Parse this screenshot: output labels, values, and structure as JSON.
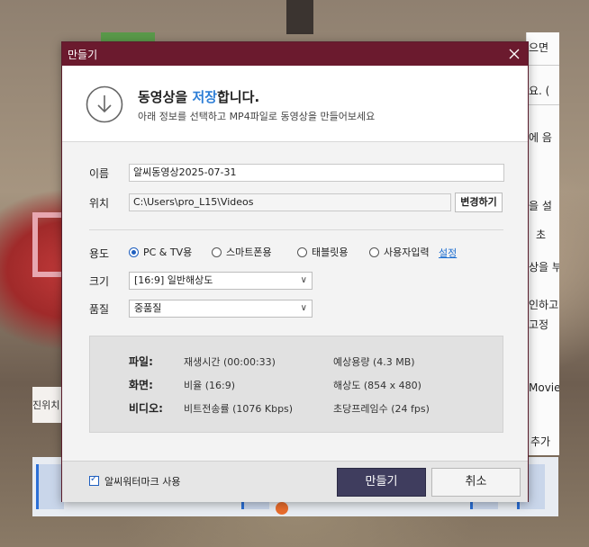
{
  "background": {
    "left_panel_text": "진위치",
    "right_panel_rows": [
      "으면",
      "요. (",
      "에 음",
      "을 설",
      "초",
      "상을 부",
      "인하고",
      "고정",
      "Movie",
      "추가"
    ]
  },
  "dialog": {
    "title": "만들기",
    "heading_prefix": "동영상을 ",
    "heading_accent": "저장",
    "heading_suffix": "합니다.",
    "subheading": "아래 정보를 선택하고 MP4파일로 동영상을 만들어보세요",
    "accent_color": "#2d7ed6",
    "titlebar_color": "#6b1a2e"
  },
  "form": {
    "name_label": "이름",
    "name_value": "알씨동영상2025-07-31",
    "location_label": "위치",
    "location_value": "C:\\Users\\pro_L15\\Videos",
    "change_button": "변경하기",
    "usage_label": "용도",
    "usage_options": [
      {
        "label": "PC & TV용",
        "selected": true
      },
      {
        "label": "스마트폰용",
        "selected": false
      },
      {
        "label": "태블릿용",
        "selected": false
      },
      {
        "label": "사용자입력",
        "selected": false
      }
    ],
    "settings_link": "설정",
    "size_label": "크기",
    "size_value": "[16:9] 일반해상도",
    "quality_label": "품질",
    "quality_value": "중품질"
  },
  "info": {
    "file_key": "파일:",
    "play_time": "재생시간 (00:00:33)",
    "expected_size": "예상용량 (4.3 MB)",
    "screen_key": "화면:",
    "ratio": "비율 (16:9)",
    "resolution": "해상도 (854 x 480)",
    "video_key": "비디오:",
    "bitrate": "비트전송률 (1076 Kbps)",
    "fps": "초당프레임수 (24 fps)"
  },
  "footer": {
    "watermark_label": "알씨워터마크 사용",
    "watermark_checked": true,
    "create_button": "만들기",
    "cancel_button": "취소"
  }
}
